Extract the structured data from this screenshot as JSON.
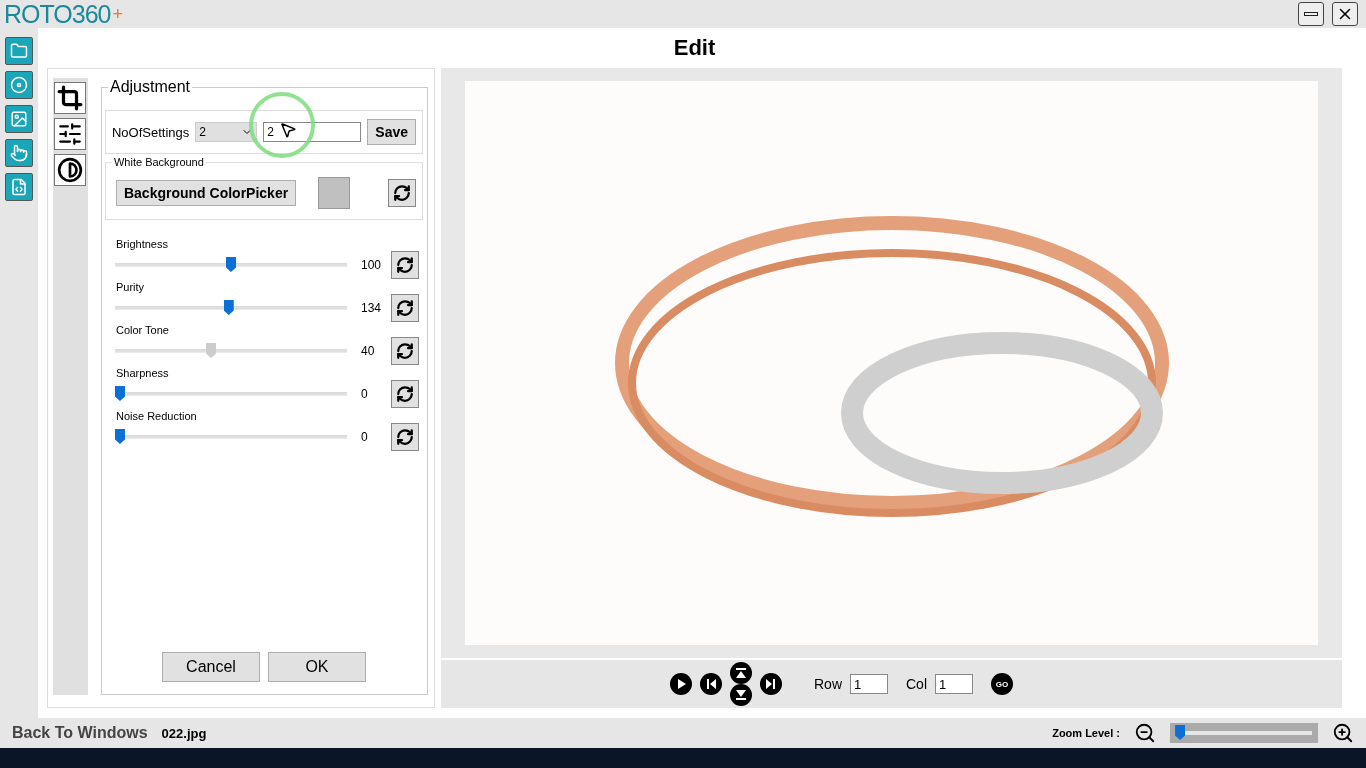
{
  "app": {
    "logo_text": "ROTO360",
    "logo_plus": "+"
  },
  "page_title": "Edit",
  "adjustment": {
    "title": "Adjustment",
    "settings_label": "NoOfSettings",
    "settings_select": "2",
    "settings_input": "2",
    "save": "Save",
    "white_bg_title": "White Background",
    "color_picker": "Background ColorPicker"
  },
  "sliders": [
    {
      "label": "Brightness",
      "value": "100",
      "level": 0.5,
      "disabled": false
    },
    {
      "label": "Purity",
      "value": "134",
      "level": 0.49,
      "disabled": false
    },
    {
      "label": "Color Tone",
      "value": "40",
      "level": 0.41,
      "disabled": true
    },
    {
      "label": "Sharpness",
      "value": "0",
      "level": 0,
      "disabled": false
    },
    {
      "label": "Noise Reduction",
      "value": "0",
      "level": 0,
      "disabled": false
    }
  ],
  "buttons": [
    "Cancel",
    "OK"
  ],
  "nav": {
    "row_label": "Row",
    "row": "1",
    "col_label": "Col",
    "col": "1",
    "go": "GO"
  },
  "footer": {
    "back": "Back To Windows",
    "file": "022.jpg",
    "zoom_label": "Zoom Level :",
    "zoom": {
      "level": 0.03
    }
  }
}
